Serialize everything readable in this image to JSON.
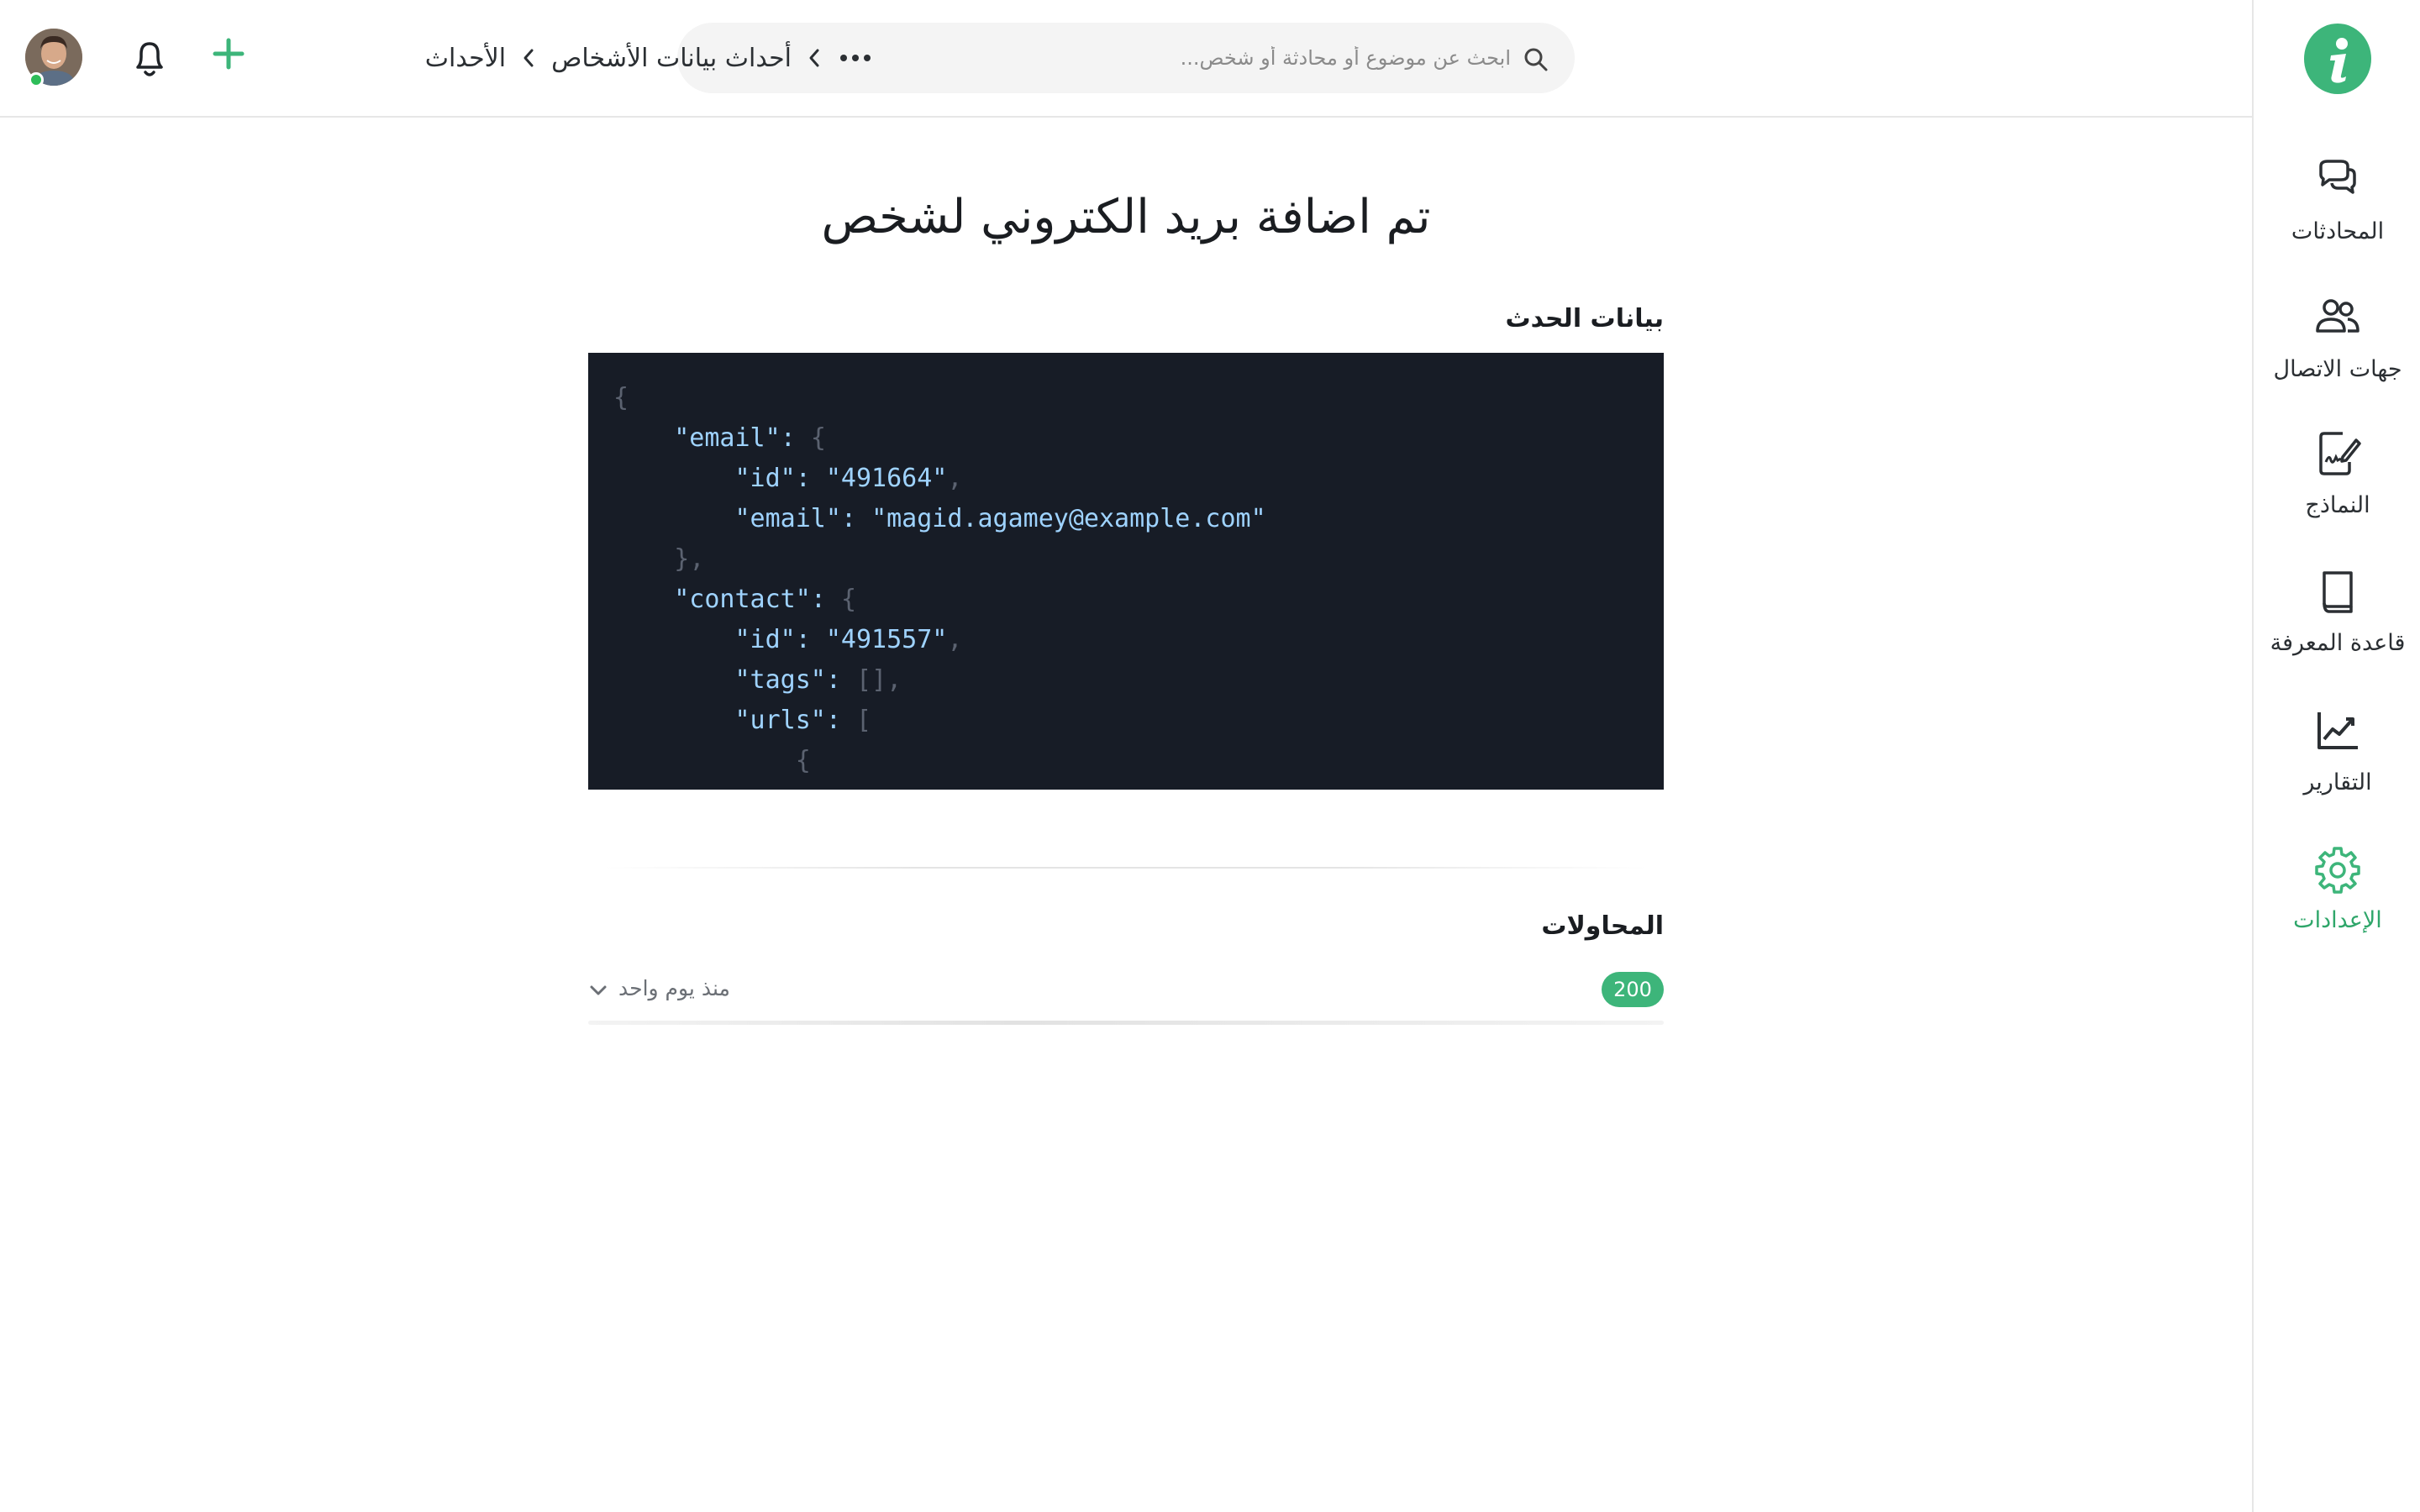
{
  "sidebar": {
    "brand_color": "#3db57a",
    "items": [
      {
        "label": "المحادثات",
        "icon": "chat-bubbles-icon"
      },
      {
        "label": "جهات الاتصال",
        "icon": "contacts-icon"
      },
      {
        "label": "النماذج",
        "icon": "form-signature-icon"
      },
      {
        "label": "قاعدة المعرفة",
        "icon": "book-icon"
      },
      {
        "label": "التقارير",
        "icon": "chart-trend-icon"
      },
      {
        "label": "الإعدادات",
        "icon": "gear-icon",
        "active": true
      }
    ]
  },
  "header": {
    "breadcrumb": [
      "أحداث بيانات الأشخاص",
      "الأحداث"
    ],
    "search": {
      "placeholder": "ابحث عن موضوع أو محادثة أو شخص..."
    }
  },
  "main": {
    "title": "تم اضافة بريد الكتروني لشخص",
    "event_data_title": "بيانات الحدث",
    "code_lines": [
      "{",
      "    \"email\": {",
      "        \"id\": \"491664\",",
      "        \"email\": \"magid.agamey@example.com\"",
      "    },",
      "    \"contact\": {",
      "        \"id\": \"491557\",",
      "        \"tags\": [],",
      "        \"urls\": [",
      "            {"
    ],
    "attempts_title": "المحاولات",
    "attempts": [
      {
        "status": "200",
        "time": "منذ يوم واحد"
      }
    ]
  }
}
